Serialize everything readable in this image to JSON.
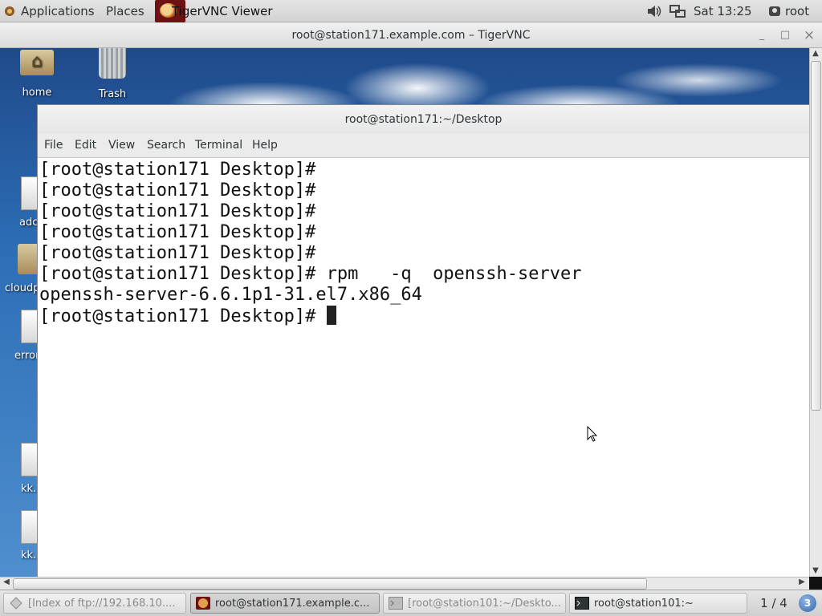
{
  "top_panel": {
    "applications": "Applications",
    "places": "Places",
    "active_app": "TigerVNC Viewer",
    "clock": "Sat 13:25",
    "user": "root",
    "icons": [
      "applications-icon",
      "tigervnc-icon",
      "volume-icon",
      "network-icon",
      "user-icon"
    ]
  },
  "vnc_window": {
    "title": "root@station171.example.com – TigerVNC",
    "minimize": "_",
    "maximize": "□",
    "close": "×"
  },
  "desktop": {
    "icons": [
      {
        "label": "home",
        "icon": "home-folder-icon"
      },
      {
        "label": "Trash",
        "icon": "trash-icon"
      }
    ],
    "edge_labels": [
      "adc",
      "cloudp",
      "error",
      "kk.p",
      "kk."
    ]
  },
  "terminal": {
    "title": "root@station171:~/Desktop",
    "menu": [
      "File",
      "Edit",
      "View",
      "Search",
      "Terminal",
      "Help"
    ],
    "lines": [
      "[root@station171 Desktop]#",
      "[root@station171 Desktop]#",
      "[root@station171 Desktop]#",
      "[root@station171 Desktop]#",
      "[root@station171 Desktop]#",
      "[root@station171 Desktop]# rpm   -q  openssh-server",
      "openssh-server-6.6.1p1-31.el7.x86_64",
      "[root@station171 Desktop]# "
    ]
  },
  "taskbar": {
    "tasks": [
      {
        "label": "[Index of ftp://192.168.10....",
        "icon": "firefox-icon",
        "state": "inactive"
      },
      {
        "label": "root@station171.example.c...",
        "icon": "tigervnc-icon",
        "state": "active"
      },
      {
        "label": "[root@station101:~/Deskto...",
        "icon": "terminal-icon",
        "state": "inactive"
      },
      {
        "label": "root@station101:~",
        "icon": "terminal-icon",
        "state": "normal"
      }
    ],
    "workspace": "1 / 4",
    "badge": "3"
  },
  "colors": {
    "panel_bg": "#dcdcdc",
    "terminal_bg": "#ffffff",
    "terminal_fg": "#111111",
    "desktop_sky": "#2d6fb8",
    "workspace_badge": "#3465a4"
  }
}
